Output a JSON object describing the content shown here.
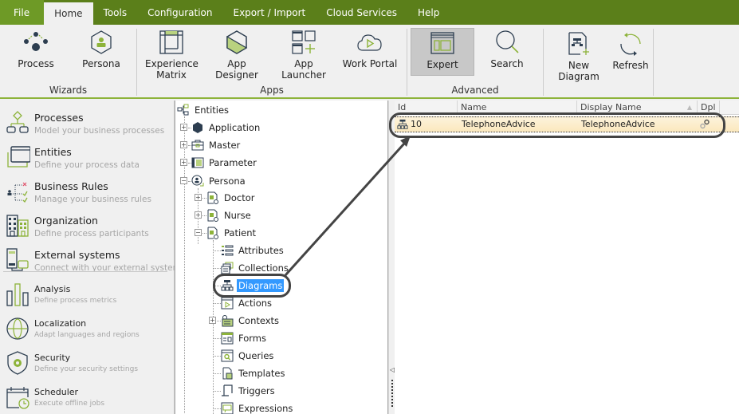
{
  "menubar": {
    "items": [
      "File",
      "Home",
      "Tools",
      "Configuration",
      "Export / Import",
      "Cloud Services",
      "Help"
    ],
    "active": "Home"
  },
  "ribbon": {
    "groups": {
      "wizards": {
        "label": "Wizards",
        "buttons": [
          "Process",
          "Persona"
        ]
      },
      "apps": {
        "label": "Apps",
        "buttons": [
          "Experience\nMatrix",
          "App Designer",
          "App Launcher",
          "Work Portal"
        ]
      },
      "advanced": {
        "label": "Advanced",
        "buttons": [
          "Expert",
          "Search"
        ]
      },
      "diagram": {
        "label": "",
        "buttons": [
          "New Diagram",
          "Refresh"
        ]
      }
    },
    "experience_line1": "Experience",
    "experience_line2": "Matrix",
    "selected": "Expert"
  },
  "sidebar": {
    "items": [
      {
        "title": "Processes",
        "subtitle": "Model your business processes",
        "icon": "processes-icon"
      },
      {
        "title": "Entities",
        "subtitle": "Define your process data",
        "icon": "entities-icon"
      },
      {
        "title": "Business Rules",
        "subtitle": "Manage your business rules",
        "icon": "business-rules-icon"
      },
      {
        "title": "Organization",
        "subtitle": "Define process participants",
        "icon": "organization-icon"
      },
      {
        "title": "External systems",
        "subtitle": "Connect with your external systems",
        "icon": "external-systems-icon"
      },
      {
        "title": "Analysis",
        "subtitle": "Define process metrics",
        "icon": "analysis-icon"
      },
      {
        "title": "Localization",
        "subtitle": "Adapt languages and regions",
        "icon": "localization-icon"
      },
      {
        "title": "Security",
        "subtitle": "Define your security settings",
        "icon": "security-icon"
      },
      {
        "title": "Scheduler",
        "subtitle": "Execute offline jobs",
        "icon": "scheduler-icon"
      }
    ]
  },
  "tree": {
    "root": "Entities",
    "nodes": {
      "application": "Application",
      "master": "Master",
      "parameter": "Parameter",
      "persona": "Persona",
      "doctor": "Doctor",
      "nurse": "Nurse",
      "patient": "Patient",
      "attributes": "Attributes",
      "collections": "Collections",
      "diagrams": "Diagrams",
      "actions": "Actions",
      "contexts": "Contexts",
      "forms": "Forms",
      "queries": "Queries",
      "templates": "Templates",
      "triggers": "Triggers",
      "expressions": "Expressions"
    },
    "selected": "Diagrams"
  },
  "grid": {
    "columns": [
      "Id",
      "Name",
      "Display Name",
      "Dpl"
    ],
    "sort_column": "Display Name",
    "rows": [
      {
        "id": "10",
        "name": "TelephoneAdvice",
        "display_name": "TelephoneAdvice",
        "dpl_icon": "gears-icon"
      }
    ]
  },
  "colors": {
    "menubar": "#5b7f1a",
    "accent": "#8db33a",
    "selection": "#3399ff",
    "row_highlight": "#fbe8bd"
  }
}
